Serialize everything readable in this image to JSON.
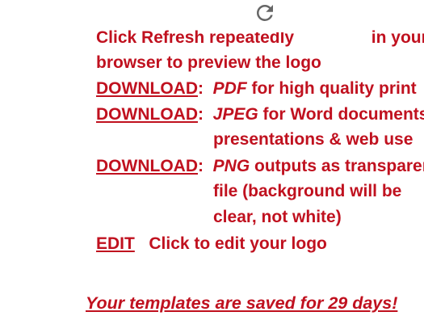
{
  "instructions": {
    "refresh_line_before": "Click Refresh repeatedly",
    "refresh_line_after": "in your",
    "refresh_line_2": "browser to preview the logo",
    "refresh_icon": "refresh-icon"
  },
  "downloads": [
    {
      "link": "DOWNLOAD",
      "sep": ":",
      "format": "PDF",
      "desc": [
        "for high quality print"
      ]
    },
    {
      "link": "DOWNLOAD",
      "sep": ":",
      "format": "JPEG",
      "desc": [
        "for Word documents,",
        "presentations & web use"
      ]
    },
    {
      "link": "DOWNLOAD",
      "sep": ":",
      "format": "PNG",
      "desc": [
        "outputs as transparent",
        "file (background will be",
        "clear, not white)"
      ]
    }
  ],
  "edit": {
    "link": "EDIT",
    "desc": "Click to edit your logo"
  },
  "footer": "Your templates are saved for 29 days!",
  "colors": {
    "text": "#c0111f",
    "icon": "#666666",
    "background": "#ffffff"
  }
}
